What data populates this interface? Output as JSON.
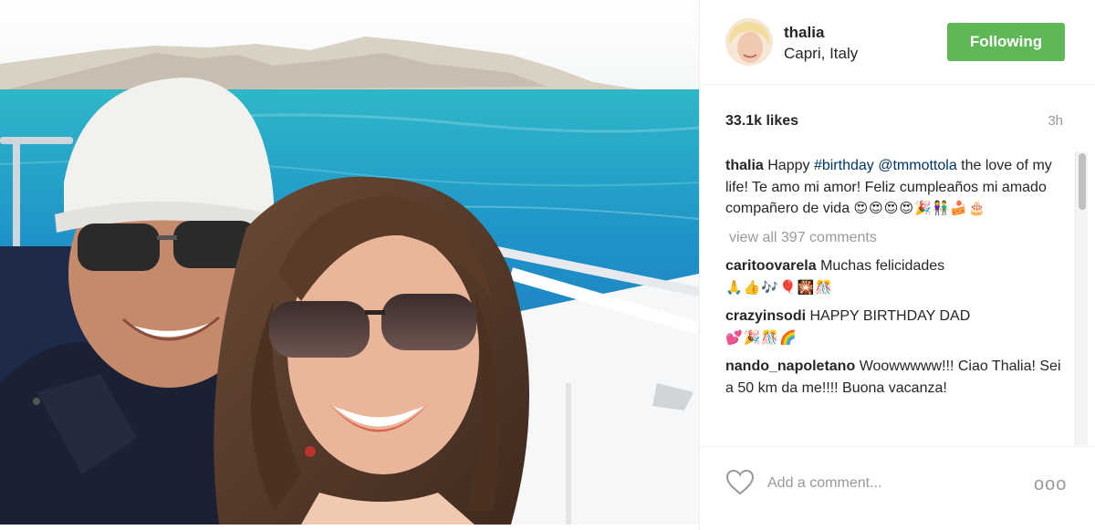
{
  "post": {
    "username": "thalia",
    "location": "Capri, Italy",
    "follow_label": "Following",
    "likes": "33.1k likes",
    "time": "3h"
  },
  "caption": {
    "author": "thalia",
    "text_before": "Happy ",
    "hashtag": "#birthday",
    "mention": "@tmmottola",
    "text_after": " the love of my life! Te amo mi amor! Feliz cumpleaños mi amado compañero de vida ",
    "emojis": "😍😍😍😍🎉👫🍰🎂"
  },
  "view_all": "view all 397 comments",
  "comments": [
    {
      "author": "caritoovarela",
      "text": "Muchas felicidades",
      "emojis": "🙏👍🎶🎈🎇🎊"
    },
    {
      "author": "crazyinsodi",
      "text": "HAPPY BIRTHDAY DAD",
      "emojis": "💕🎉🎊🌈"
    },
    {
      "author": "nando_napoletano",
      "text": "Woowwwww!!! Ciao Thalia! Sei a 50 km da me!!!! Buona vacanza!",
      "emojis": ""
    }
  ],
  "footer": {
    "comment_placeholder": "Add a comment...",
    "more_label": "ooo"
  },
  "icons": {
    "like": "heart-icon",
    "more": "more-options-icon"
  },
  "colors": {
    "follow_button": "#5fb856",
    "link": "#003569",
    "muted": "#999999"
  }
}
